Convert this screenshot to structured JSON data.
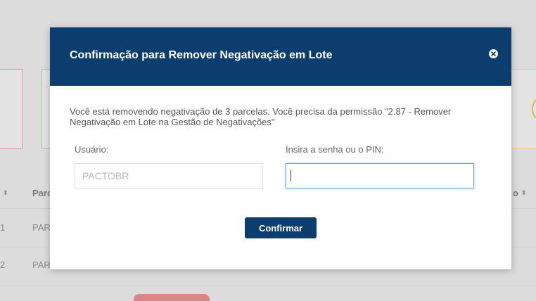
{
  "background": {
    "table_headers": {
      "parcela": "Parc",
      "last_col_suffix": "o"
    },
    "rows": [
      {
        "index": "1",
        "parcela": "PAR"
      },
      {
        "index": "2",
        "parcela": "PAR"
      }
    ],
    "sort_indicator": "⬍"
  },
  "modal": {
    "title": "Confirmação para Remover Negativação em Lote",
    "message": "Você está removendo negativação de 3 parcelas. Você precisa da permissão \"2.87 - Remover Negativação em Lote na Gestão de Negativações\"",
    "user_label": "Usuário:",
    "user_value": "PACTOBR",
    "password_label": "Insira a senha ou o PIN:",
    "password_value": "",
    "confirm_label": "Confirmar",
    "close_icon": "close-circle-icon"
  },
  "colors": {
    "header_bg": "#0b3d6e",
    "button_bg": "#0b3d6e",
    "focus_border": "#6aa9e0"
  }
}
